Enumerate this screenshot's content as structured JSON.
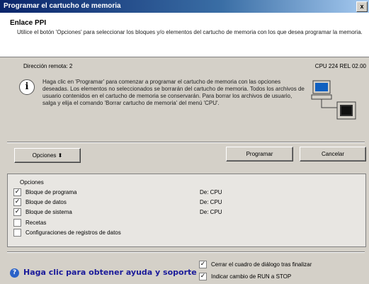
{
  "window": {
    "title": "Programar el cartucho de memoria",
    "close_label": "x"
  },
  "header": {
    "title": "Enlace PPI",
    "description": "Utilice el botón 'Opciones' para seleccionar los bloques y/o elementos del cartucho de memoria con los que desea programar la memoria."
  },
  "info": {
    "remote_address": "Dirección remota: 2",
    "cpu": "CPU 224 REL 02.00",
    "message": "Haga clic en 'Programar' para comenzar a programar el cartucho de memoria con las opciones deseadas. Los elementos no seleccionados se borrarán del cartucho de memoria. Todos los archivos de usuario contenidos en el cartucho de memoria se conservarán. Para borrar los archivos de usuario, salga y elija el comando 'Borrar cartucho de memoria' del menú 'CPU'."
  },
  "buttons": {
    "options": "Opciones  ⬍",
    "program": "Programar",
    "cancel": "Cancelar"
  },
  "options": {
    "title": "Opciones",
    "items": [
      {
        "label": "Bloque de programa",
        "checked": true,
        "from": "De: CPU"
      },
      {
        "label": "Bloque de datos",
        "checked": true,
        "from": "De: CPU"
      },
      {
        "label": "Bloque de sistema",
        "checked": true,
        "from": "De: CPU"
      },
      {
        "label": "Recetas",
        "checked": false,
        "from": ""
      },
      {
        "label": "Configuraciones de registros de datos",
        "checked": false,
        "from": ""
      }
    ]
  },
  "footer": {
    "help_text": "Haga clic para obtener ayuda y soporte",
    "close_after": "Cerrar el cuadro de diálogo tras finalizar",
    "indicate_run_stop": "Indicar cambio de RUN a STOP"
  }
}
